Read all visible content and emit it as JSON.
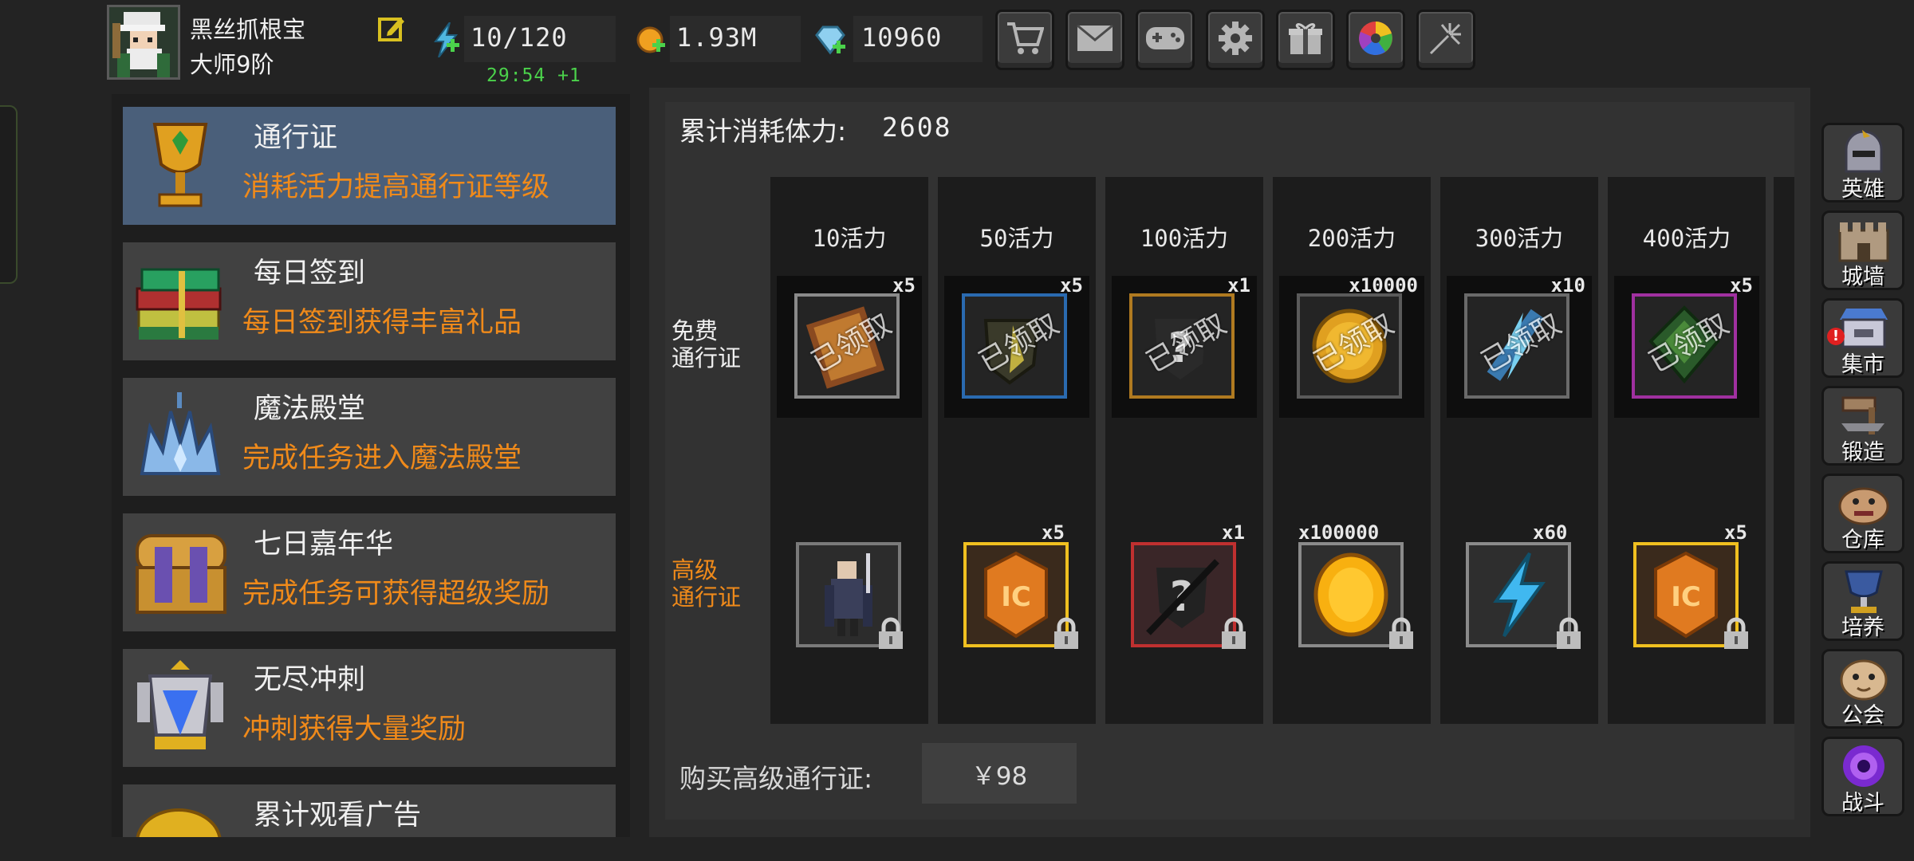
{
  "player": {
    "name": "黑丝抓根宝",
    "rank": "大师9阶"
  },
  "resources": {
    "energy": "10/120",
    "energy_timer": "29:54 +1",
    "gold": "1.93M",
    "gems": "10960"
  },
  "top_buttons": [
    "shop-cart-icon",
    "mail-icon",
    "gamepad-icon",
    "gear-icon",
    "gift-icon",
    "color-wheel-icon",
    "firework-icon"
  ],
  "menu": {
    "items": [
      {
        "title": "通行证",
        "subtitle": "消耗活力提高通行证等级",
        "icon": "golden-chalice-icon",
        "active": true
      },
      {
        "title": "每日签到",
        "subtitle": "每日签到获得丰富礼品",
        "icon": "green-book-stack-icon",
        "active": false
      },
      {
        "title": "魔法殿堂",
        "subtitle": "完成任务进入魔法殿堂",
        "icon": "ice-crystal-crown-icon",
        "active": false
      },
      {
        "title": "七日嘉年华",
        "subtitle": "完成任务可获得超级奖励",
        "icon": "treasure-chest-icon",
        "active": false
      },
      {
        "title": "无尽冲刺",
        "subtitle": "冲刺获得大量奖励",
        "icon": "crystal-trophy-icon",
        "active": false
      },
      {
        "title": "累计观看广告",
        "subtitle": "",
        "icon": "gold-coin-icon",
        "active": false
      }
    ]
  },
  "pass": {
    "stamina_label": "累计消耗体力:",
    "stamina_value": "2608",
    "free_row_label": [
      "免费",
      "通行证"
    ],
    "premium_row_label": [
      "高级",
      "通行证"
    ],
    "claimed_text": "已领取",
    "tiers": [
      {
        "label": "10活力",
        "free_qty": "x5",
        "premium_qty": ""
      },
      {
        "label": "50活力",
        "free_qty": "x5",
        "premium_qty": "x5"
      },
      {
        "label": "100活力",
        "free_qty": "x1",
        "premium_qty": "x1"
      },
      {
        "label": "200活力",
        "free_qty": "x10000",
        "premium_qty": "x100000"
      },
      {
        "label": "300活力",
        "free_qty": "x10",
        "premium_qty": "x60"
      },
      {
        "label": "400活力",
        "free_qty": "x5",
        "premium_qty": "x5"
      }
    ],
    "buy_label": "购买高级通行证:",
    "buy_price": "￥98"
  },
  "right_nav": [
    {
      "label": "英雄",
      "icon": "knight-helmet-icon"
    },
    {
      "label": "城墙",
      "icon": "castle-wall-icon"
    },
    {
      "label": "集市",
      "icon": "market-stall-icon",
      "alert": "!"
    },
    {
      "label": "锻造",
      "icon": "anvil-hammer-icon"
    },
    {
      "label": "仓库",
      "icon": "warehouse-creature-icon"
    },
    {
      "label": "培养",
      "icon": "chalice-icon"
    },
    {
      "label": "公会",
      "icon": "guild-beast-icon"
    },
    {
      "label": "战斗",
      "icon": "purple-portal-icon"
    }
  ],
  "colors": {
    "accent_orange": "#f08a1a",
    "active_menu": "#4a5f7a",
    "timer_green": "#4bd24b"
  }
}
